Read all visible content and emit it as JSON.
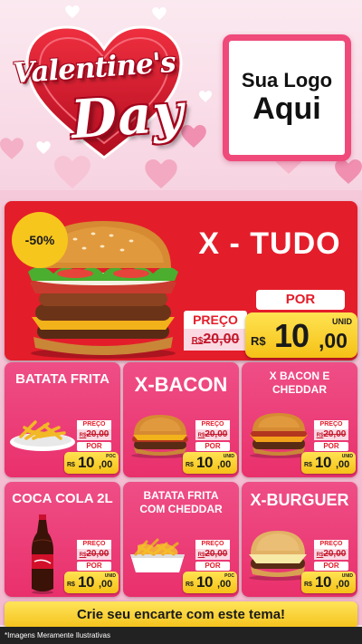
{
  "header": {
    "title_line1": "Valentine's",
    "title_line2": "Day",
    "logo_line1": "Sua Logo",
    "logo_line2": "Aqui"
  },
  "featured": {
    "badge": "-50%",
    "name": "X - TUDO",
    "preco_label": "PREÇO",
    "old_currency": "R$",
    "old_price": "20,00",
    "por_label": "POR",
    "currency": "R$",
    "price_int": "10",
    "price_dec": ",00",
    "unit": "UNID"
  },
  "products": [
    {
      "name": "BATATA FRITA",
      "preco_label": "PREÇO",
      "old_currency": "R$",
      "old_price": "20,00",
      "por_label": "POR",
      "currency": "R$",
      "price_int": "10",
      "price_dec": ",00",
      "unit": "POC"
    },
    {
      "name": "X-BACON",
      "preco_label": "PREÇO",
      "old_currency": "R$",
      "old_price": "20,00",
      "por_label": "POR",
      "currency": "R$",
      "price_int": "10",
      "price_dec": ",00",
      "unit": "UNID"
    },
    {
      "name": "X BACON E CHEDDAR",
      "preco_label": "PREÇO",
      "old_currency": "R$",
      "old_price": "20,00",
      "por_label": "POR",
      "currency": "R$",
      "price_int": "10",
      "price_dec": ",00",
      "unit": "UNID"
    },
    {
      "name": "COCA COLA 2L",
      "preco_label": "PREÇO",
      "old_currency": "R$",
      "old_price": "20,00",
      "por_label": "POR",
      "currency": "R$",
      "price_int": "10",
      "price_dec": ",00",
      "unit": "UNID"
    },
    {
      "name": "BATATA FRITA COM CHEDDAR",
      "preco_label": "PREÇO",
      "old_currency": "R$",
      "old_price": "20,00",
      "por_label": "POR",
      "currency": "R$",
      "price_int": "10",
      "price_dec": ",00",
      "unit": "POC"
    },
    {
      "name": "X-BURGUER",
      "preco_label": "PREÇO",
      "old_currency": "R$",
      "old_price": "20,00",
      "por_label": "POR",
      "currency": "R$",
      "price_int": "10",
      "price_dec": ",00",
      "unit": "UNID"
    }
  ],
  "cta": "Crie seu encarte com este tema!",
  "footer_note": "*Imagens Meramente Ilustrativas",
  "colors": {
    "featured_bg": "#e41d2a",
    "card_bg": "#e9306c",
    "price_tag": "#f5c116",
    "logo_border": "#ef4a7a",
    "heart_red": "#d4122a"
  },
  "icons": [
    "heart-icon",
    "burger-image",
    "fries-image",
    "soda-bottle-image"
  ]
}
